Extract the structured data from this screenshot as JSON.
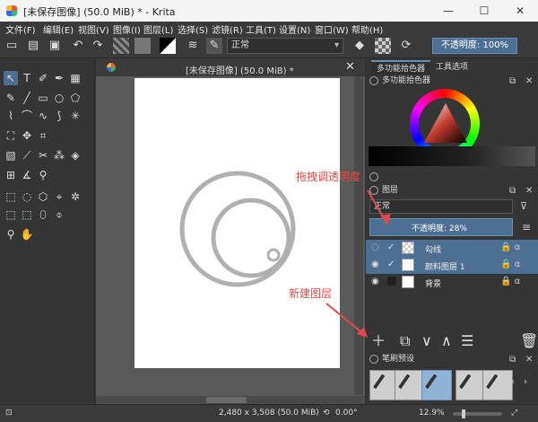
{
  "window": {
    "title": "[未保存图像] (50.0 MiB) * - Krita",
    "minimize": "—",
    "maximize": "☐",
    "close": "✕"
  },
  "menu": [
    "文件(F)",
    "编辑(E)",
    "视图(V)",
    "图像(I)",
    "图层(L)",
    "选择(S)",
    "滤镜(R)",
    "工具(T)",
    "设置(N)",
    "窗口(W)",
    "帮助(H)"
  ],
  "toolbar": {
    "blend_mode": "正常",
    "opacity_label": "不透明度: 100%"
  },
  "document": {
    "tab_title": "[未保存图像] (50.0 MiB) *"
  },
  "dock": {
    "tabs": [
      "多功能拾色器",
      "工具选项"
    ],
    "color_panel_title": "多功能拾色器",
    "layers_panel_title": "图层",
    "layer_blend_mode": "正常",
    "layer_opacity": "不透明度: 28%",
    "layers": [
      {
        "name": "勾线",
        "selected": true
      },
      {
        "name": "颜料图层 1",
        "selected": true
      },
      {
        "name": "背景",
        "selected": false
      }
    ],
    "brush_panel_title": "笔刷预设"
  },
  "status": {
    "dimensions": "2,480 x 3,508 (50.0 MiB)",
    "rotation": "0.00°",
    "zoom": "12.9%"
  },
  "annotations": {
    "drag_opacity": "拖拽调透明度",
    "new_layer": "新建图层"
  },
  "colors": {
    "accent": "#4e6f94",
    "annotation_red": "#e24a4a"
  }
}
